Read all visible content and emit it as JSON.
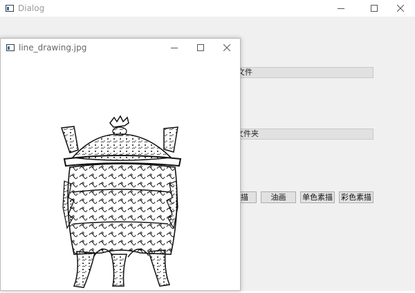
{
  "dialog": {
    "title": "Dialog",
    "file_field_text": "文件",
    "folder_field_text": "文件夹",
    "buttons": {
      "sketch": "描",
      "oil_painting": "油画",
      "mono_sketch": "单色素描",
      "color_sketch": "彩色素描"
    }
  },
  "viewer": {
    "title": "line_drawing.jpg"
  },
  "icons": {
    "minimize": "minimize-icon",
    "maximize": "maximize-icon",
    "close": "close-icon",
    "app": "app-window-icon"
  }
}
